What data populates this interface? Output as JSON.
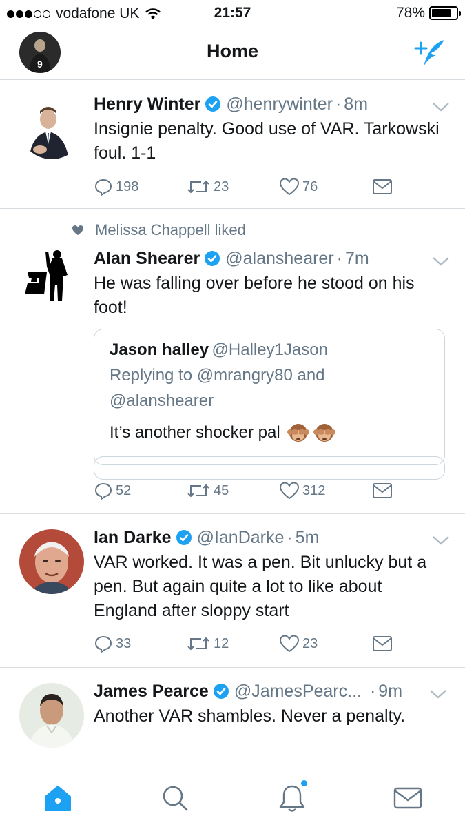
{
  "status_bar": {
    "carrier": "vodafone UK",
    "time": "21:57",
    "battery": "78%",
    "battery_level": 0.78
  },
  "nav": {
    "title": "Home"
  },
  "tweets": [
    {
      "name": "Henry Winter",
      "handle": "@henrywinter",
      "time": "8m",
      "text": "Insignie penalty. Good use of VAR. Tarkowski foul. 1-1",
      "replies": "198",
      "retweets": "23",
      "likes": "76"
    },
    {
      "social_context": "Melissa Chappell liked",
      "name": "Alan Shearer",
      "handle": "@alanshearer",
      "time": "7m",
      "text": "He was falling over before he stood on his foot!",
      "quote": {
        "name": "Jason halley",
        "handle": "@Halley1Jason",
        "reply_line1": "Replying to @mrangry80 and",
        "reply_line2": "@alanshearer",
        "text": "It’s another shocker pal"
      },
      "replies": "52",
      "retweets": "45",
      "likes": "312"
    },
    {
      "name": "Ian Darke",
      "handle": "@IanDarke",
      "time": "5m",
      "text": "VAR worked. It was a pen. Bit unlucky but a pen. But again quite a lot to like about England after sloppy start",
      "replies": "33",
      "retweets": "12",
      "likes": "23"
    },
    {
      "name": "James Pearce",
      "handle": "@JamesPearc...",
      "time": "9m",
      "text": "Another VAR shambles. Never a penalty."
    }
  ],
  "colors": {
    "accent": "#1da1f2",
    "muted": "#657786",
    "divider": "#d8dde2"
  },
  "icons": {
    "tabs": [
      "home-icon",
      "search-icon",
      "notifications-icon",
      "messages-icon"
    ]
  }
}
